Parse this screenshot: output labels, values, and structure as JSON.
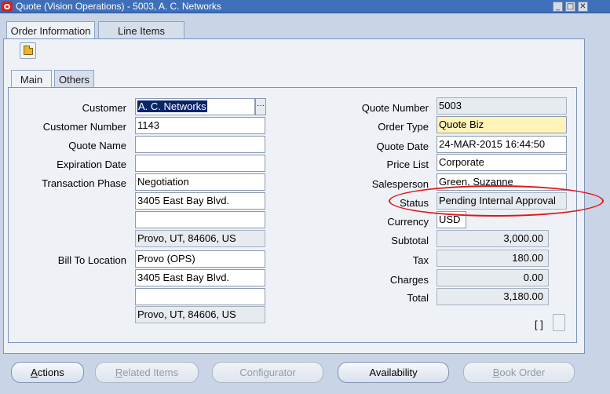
{
  "window": {
    "title": "Quote (Vision Operations) - 5003, A. C. Networks",
    "controls": [
      "minimize-icon",
      "maximize-icon",
      "close-icon"
    ]
  },
  "tabs": {
    "order_info": "Order Information",
    "line_items": "Line Items"
  },
  "subtabs": {
    "main": "Main",
    "others": "Others"
  },
  "left_fields": {
    "customer": {
      "label": "Customer",
      "value": "A. C. Networks"
    },
    "customer_number": {
      "label": "Customer Number",
      "value": "1143"
    },
    "quote_name": {
      "label": "Quote Name",
      "value": ""
    },
    "expiration_date": {
      "label": "Expiration Date",
      "value": ""
    },
    "transaction_phase": {
      "label": "Transaction Phase",
      "value": "Negotiation"
    },
    "address_line1": "3405 East Bay Blvd.",
    "address_line2": "",
    "address_city": "Provo, UT, 84606, US",
    "bill_to_location": {
      "label": "Bill To Location",
      "value": "Provo (OPS)"
    },
    "bill_address_line1": "3405 East Bay Blvd.",
    "bill_address_line2": "",
    "bill_address_city": "Provo, UT, 84606, US"
  },
  "right_fields": {
    "quote_number": {
      "label": "Quote Number",
      "value": "5003"
    },
    "order_type": {
      "label": "Order Type",
      "value": "Quote Biz"
    },
    "quote_date": {
      "label": "Quote Date",
      "value": "24-MAR-2015 16:44:50"
    },
    "price_list": {
      "label": "Price List",
      "value": "Corporate"
    },
    "salesperson": {
      "label": "Salesperson",
      "value": "Green, Suzanne"
    },
    "status": {
      "label": "Status",
      "value": "Pending Internal Approval"
    },
    "currency": {
      "label": "Currency",
      "value": "USD"
    },
    "subtotal": {
      "label": "Subtotal",
      "value": "3,000.00"
    },
    "tax": {
      "label": "Tax",
      "value": "180.00"
    },
    "charges": {
      "label": "Charges",
      "value": "0.00"
    },
    "total": {
      "label": "Total",
      "value": "3,180.00"
    }
  },
  "folder_indicator": "[ ]",
  "buttons": {
    "actions": "Actions",
    "related_items": "Related Items",
    "configurator": "Configurator",
    "availability": "Availability",
    "book_order": "Book Order"
  },
  "colors": {
    "title_bar": "#3e6fb8",
    "required_field": "#fff3b8",
    "annotation": "#e0161b"
  }
}
